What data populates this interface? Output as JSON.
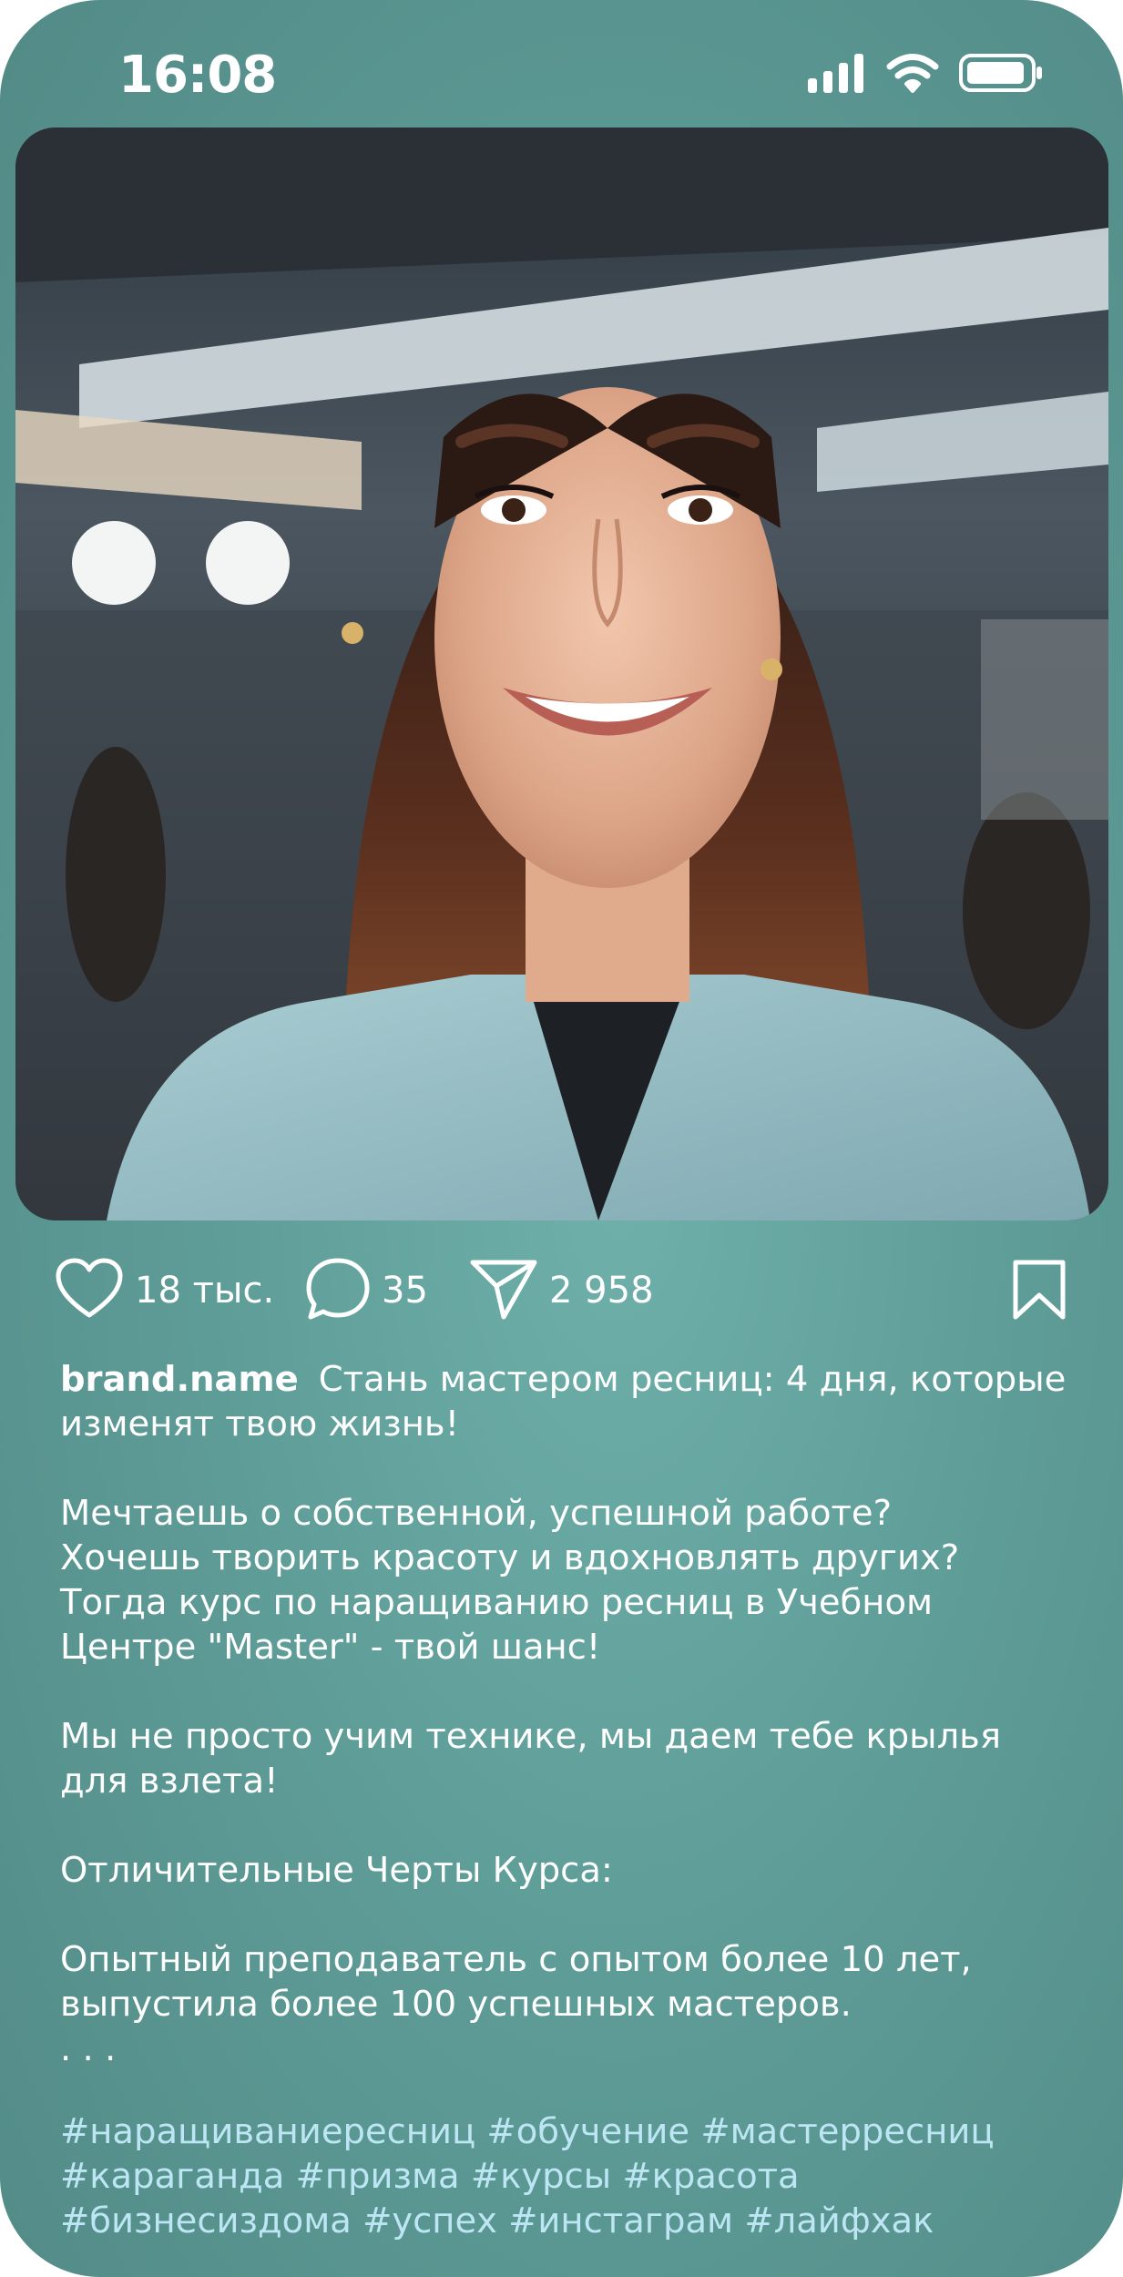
{
  "status_bar": {
    "time": "16:08",
    "icons": [
      "signal-icon",
      "wifi-icon",
      "battery-icon"
    ]
  },
  "post": {
    "image": "portrait-photo",
    "actions": {
      "likes": "18 тыс.",
      "comments": "35",
      "shares": "2 958"
    },
    "username": "brand.name",
    "caption_lines": [
      "Стань мастером ресниц: 4 дня, которые",
      "изменят твою жизнь!",
      "",
      "Мечтаешь о собственной, успешной работе?",
      "Хочешь творить красоту и вдохновлять других?",
      "Тогда курс по наращиванию ресниц в Учебном",
      "Центре \"Master\" - твой шанс!",
      "",
      "Мы не просто учим технике, мы даем тебе крылья",
      "для взлета!",
      "",
      "Отличительные Черты Курса:",
      "",
      "Опытный преподаватель с опытом более 10 лет,",
      "выпустила более 100 успешных мастеров.",
      ". . ."
    ],
    "hashtag_lines": [
      "#наращиваниересниц #обучение #мастерресниц",
      "#караганда #призма #курсы #красота",
      "#бизнесиздома #успех #инстаграм #лайфхак"
    ]
  },
  "colors": {
    "background": "#5f9d98",
    "text": "#ffffff",
    "hashtag": "#bde6f4"
  }
}
